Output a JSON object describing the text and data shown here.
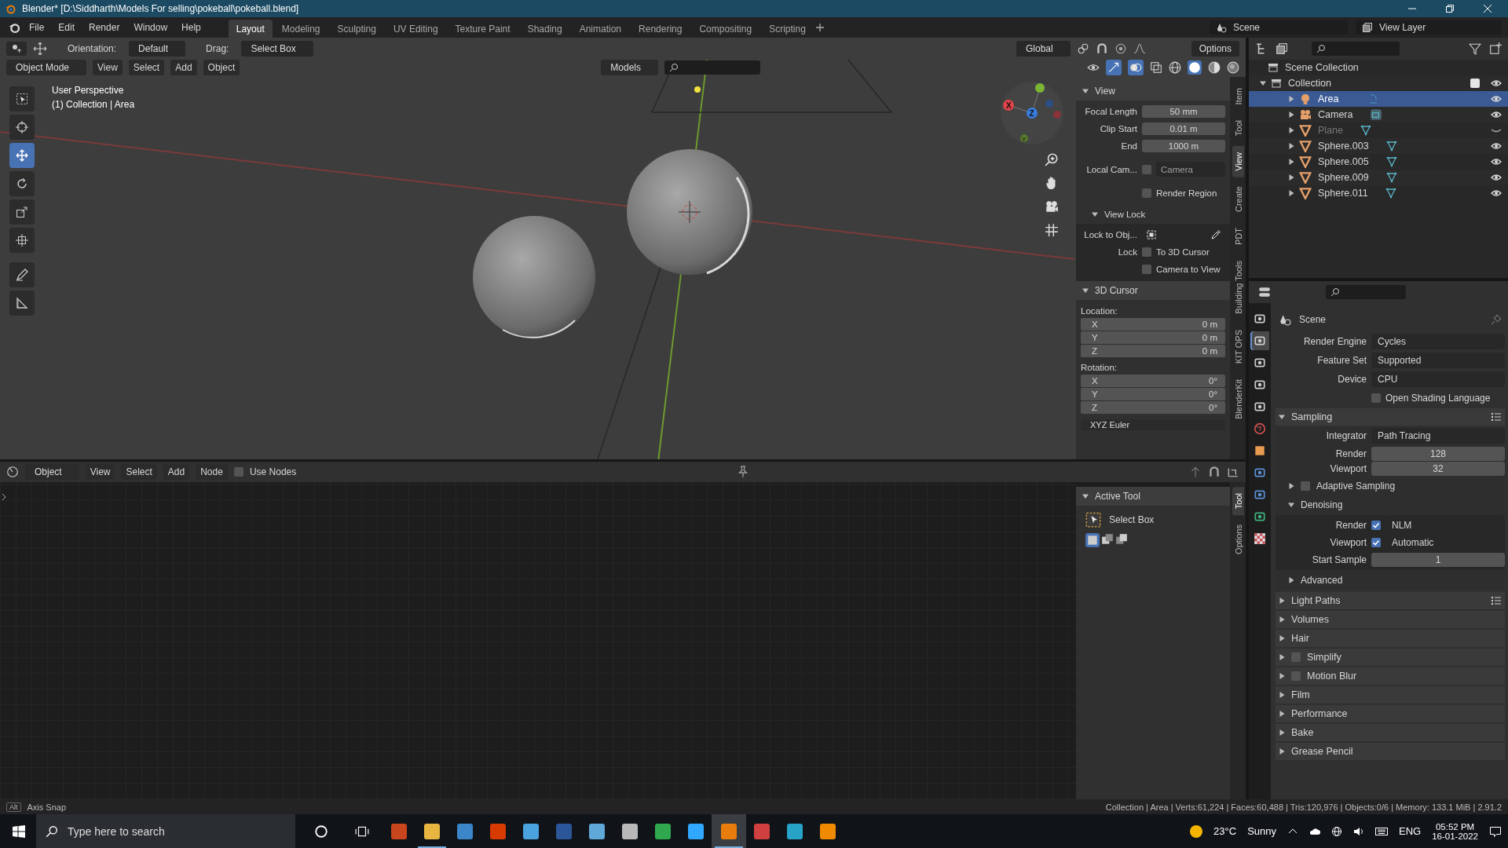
{
  "window": {
    "title": "Blender* [D:\\Siddharth\\Models For selling\\pokeball\\pokeball.blend]"
  },
  "menu": [
    "File",
    "Edit",
    "Render",
    "Window",
    "Help"
  ],
  "workspaces": [
    {
      "label": "Layout",
      "selected": true
    },
    {
      "label": "Modeling",
      "selected": false
    },
    {
      "label": "Sculpting",
      "selected": false
    },
    {
      "label": "UV Editing",
      "selected": false
    },
    {
      "label": "Texture Paint",
      "selected": false
    },
    {
      "label": "Shading",
      "selected": false
    },
    {
      "label": "Animation",
      "selected": false
    },
    {
      "label": "Rendering",
      "selected": false
    },
    {
      "label": "Compositing",
      "selected": false
    },
    {
      "label": "Scripting",
      "selected": false
    }
  ],
  "scene": "Scene",
  "view_layer": "View Layer",
  "tool_settings": {
    "orientation_label": "Orientation:",
    "orientation": "Default",
    "drag_label": "Drag:",
    "drag": "Select Box",
    "transform": "Global",
    "options": "Options"
  },
  "viewport": {
    "mode": "Object Mode",
    "menus": [
      "View",
      "Select",
      "Add",
      "Object"
    ],
    "asset_library": "Models",
    "overlay_lines": [
      "User Perspective",
      "(1) Collection | Area"
    ]
  },
  "gizmo_axes": [
    "X",
    "Z",
    "Y"
  ],
  "tools": [
    {
      "kind": "select",
      "selected": false
    },
    {
      "kind": "cursor",
      "selected": false
    },
    {
      "kind": "move",
      "selected": true
    },
    {
      "kind": "rotate",
      "selected": false
    },
    {
      "kind": "scale",
      "selected": false
    },
    {
      "kind": "transform",
      "selected": false
    },
    {
      "kind": "annotate",
      "selected": false
    },
    {
      "kind": "measure",
      "selected": false
    }
  ],
  "sidebar_tabs": [
    {
      "label": "Item",
      "selected": false
    },
    {
      "label": "Tool",
      "selected": false
    },
    {
      "label": "View",
      "selected": true
    },
    {
      "label": "Create",
      "selected": false
    },
    {
      "label": "PDT",
      "selected": false
    },
    {
      "label": "Building Tools",
      "selected": false
    },
    {
      "label": "KIT OPS",
      "selected": false
    },
    {
      "label": "BlenderKit",
      "selected": false
    }
  ],
  "view_panel": {
    "title": "View",
    "fields": [
      {
        "label": "Focal Length",
        "value": "50 mm"
      },
      {
        "label": "Clip Start",
        "value": "0.01 m"
      },
      {
        "label": "End",
        "value": "1000 m"
      }
    ],
    "local_camera": {
      "label": "Local Cam...",
      "checked": false,
      "value": "Camera"
    },
    "render_region": {
      "label": "Render Region",
      "checked": false
    },
    "view_lock": {
      "title": "View Lock",
      "lock_to_label": "Lock to Obj...",
      "lock_label": "Lock",
      "options": [
        {
          "label": "To 3D Cursor",
          "checked": false
        },
        {
          "label": "Camera to View",
          "checked": false
        }
      ]
    }
  },
  "cursor_panel": {
    "title": "3D Cursor",
    "location_label": "Location:",
    "location": [
      {
        "axis": "X",
        "value": "0 m"
      },
      {
        "axis": "Y",
        "value": "0 m"
      },
      {
        "axis": "Z",
        "value": "0 m"
      }
    ],
    "rotation_label": "Rotation:",
    "rotation": [
      {
        "axis": "X",
        "value": "0°"
      },
      {
        "axis": "Y",
        "value": "0°"
      },
      {
        "axis": "Z",
        "value": "0°"
      }
    ],
    "rotation_mode": "XYZ Euler"
  },
  "outliner": {
    "root": "Scene Collection",
    "collection": {
      "label": "Collection",
      "checked": true,
      "expanded": true,
      "children": [
        {
          "label": "Area",
          "kind": "light",
          "selected": true,
          "visible": true
        },
        {
          "label": "Camera",
          "kind": "camera",
          "selected": false,
          "visible": true
        },
        {
          "label": "Plane",
          "kind": "mesh",
          "selected": false,
          "visible": false
        },
        {
          "label": "Sphere.003",
          "kind": "mesh",
          "selected": false,
          "visible": true
        },
        {
          "label": "Sphere.005",
          "kind": "mesh",
          "selected": false,
          "visible": true
        },
        {
          "label": "Sphere.009",
          "kind": "mesh",
          "selected": false,
          "visible": true
        },
        {
          "label": "Sphere.011",
          "kind": "mesh",
          "selected": false,
          "visible": true
        }
      ]
    }
  },
  "node_editor": {
    "type": "Object",
    "menus": [
      "View",
      "Select",
      "Add",
      "Node"
    ],
    "use_nodes": {
      "label": "Use Nodes",
      "checked": false
    }
  },
  "active_tool": {
    "title": "Active Tool",
    "tool": "Select Box",
    "tabs": [
      {
        "label": "Tool",
        "selected": true
      },
      {
        "label": "Options",
        "selected": false
      }
    ]
  },
  "properties": {
    "title": "Scene",
    "tabs": [
      {
        "kind": "tool",
        "selected": false
      },
      {
        "kind": "render",
        "selected": true
      },
      {
        "kind": "output",
        "selected": false
      },
      {
        "kind": "view-layer",
        "selected": false
      },
      {
        "kind": "scene",
        "selected": false
      },
      {
        "kind": "world",
        "selected": false
      },
      {
        "kind": "object",
        "selected": false
      },
      {
        "kind": "physics",
        "selected": false
      },
      {
        "kind": "constraints",
        "selected": false
      },
      {
        "kind": "data",
        "selected": false
      },
      {
        "kind": "texture",
        "selected": false
      }
    ],
    "render_rows": [
      {
        "label": "Render Engine",
        "value": "Cycles"
      },
      {
        "label": "Feature Set",
        "value": "Supported"
      },
      {
        "label": "Device",
        "value": "CPU"
      }
    ],
    "osl": {
      "label": "Open Shading Language",
      "checked": false
    },
    "sampling": {
      "title": "Sampling",
      "expanded": true,
      "integrator": {
        "label": "Integrator",
        "value": "Path Tracing"
      },
      "samples": [
        {
          "label": "Render",
          "value": "128"
        },
        {
          "label": "Viewport",
          "value": "32"
        }
      ],
      "adaptive": {
        "label": "Adaptive Sampling",
        "checked": false,
        "expanded": false
      },
      "denoising": {
        "label": "Denoising",
        "expanded": true,
        "rows": [
          {
            "label": "Render",
            "checked": true,
            "value": "NLM"
          },
          {
            "label": "Viewport",
            "checked": true,
            "value": "Automatic"
          }
        ],
        "start_sample": {
          "label": "Start Sample",
          "value": "1"
        }
      },
      "advanced": {
        "label": "Advanced",
        "expanded": false
      }
    },
    "sections": [
      {
        "label": "Light Paths",
        "kind": "plain",
        "presets": true
      },
      {
        "label": "Volumes",
        "kind": "plain",
        "presets": false
      },
      {
        "label": "Hair",
        "kind": "plain",
        "presets": false
      },
      {
        "label": "Simplify",
        "kind": "checkbox",
        "checked": false,
        "presets": false
      },
      {
        "label": "Motion Blur",
        "kind": "checkbox",
        "checked": false,
        "presets": false
      },
      {
        "label": "Film",
        "kind": "plain",
        "presets": false
      },
      {
        "label": "Performance",
        "kind": "plain",
        "presets": false
      },
      {
        "label": "Bake",
        "kind": "plain",
        "presets": false
      },
      {
        "label": "Grease Pencil",
        "kind": "plain",
        "presets": false
      }
    ]
  },
  "status_bar": {
    "key": "Alt",
    "hint": "Axis Snap",
    "stats": "Collection | Area | Verts:61,224 | Faces:60,488 | Tris:120,976 | Objects:0/6 | Memory: 133.1 MiB | 2.91.2"
  },
  "taskbar": {
    "search_placeholder": "Type here to search",
    "apps": [
      {
        "color": "#c8461e",
        "open": false,
        "selected": false
      },
      {
        "color": "#e8b640",
        "open": true,
        "selected": false
      },
      {
        "color": "#3a86c8",
        "open": false,
        "selected": false
      },
      {
        "color": "#d83b01",
        "open": false,
        "selected": false
      },
      {
        "color": "#4aa3df",
        "open": false,
        "selected": false
      },
      {
        "color": "#2b579a",
        "open": false,
        "selected": false
      },
      {
        "color": "#5fa8d8",
        "open": false,
        "selected": false
      },
      {
        "color": "#b8b8b8",
        "open": false,
        "selected": false
      },
      {
        "color": "#2fa84f",
        "open": false,
        "selected": false
      },
      {
        "color": "#31a8ff",
        "open": false,
        "selected": false
      },
      {
        "color": "#e87d0d",
        "open": true,
        "selected": true
      },
      {
        "color": "#d04040",
        "open": false,
        "selected": false
      },
      {
        "color": "#27a3c8",
        "open": false,
        "selected": false
      },
      {
        "color": "#f08a00",
        "open": false,
        "selected": false
      }
    ],
    "temperature": "23°C",
    "weather": "Sunny",
    "language": "ENG",
    "time": "05:52 PM",
    "date": "16-01-2022"
  }
}
